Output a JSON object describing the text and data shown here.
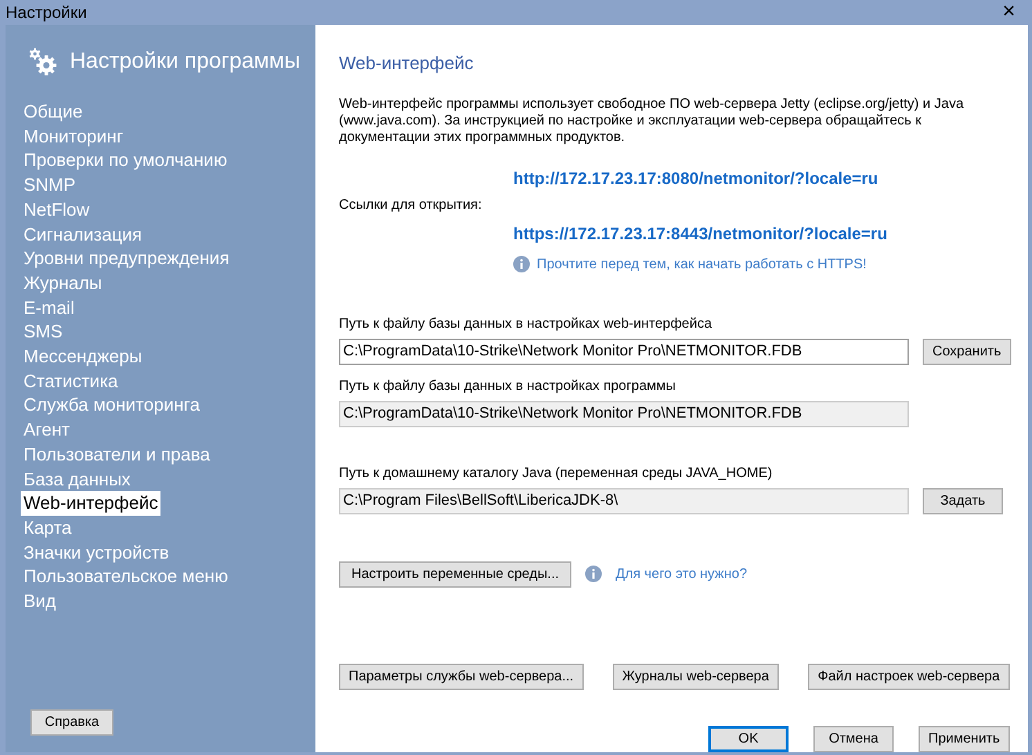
{
  "window": {
    "title": "Настройки",
    "close": "×"
  },
  "sidebar": {
    "title": "Настройки программы",
    "items": [
      {
        "label": "Общие",
        "selected": false
      },
      {
        "label": "Мониторинг",
        "selected": false
      },
      {
        "label": "Проверки по умолчанию",
        "selected": false
      },
      {
        "label": "SNMP",
        "selected": false
      },
      {
        "label": "NetFlow",
        "selected": false
      },
      {
        "label": "Сигнализация",
        "selected": false
      },
      {
        "label": "Уровни предупреждения",
        "selected": false
      },
      {
        "label": "Журналы",
        "selected": false
      },
      {
        "label": "E-mail",
        "selected": false
      },
      {
        "label": "SMS",
        "selected": false
      },
      {
        "label": "Мессенджеры",
        "selected": false
      },
      {
        "label": "Статистика",
        "selected": false
      },
      {
        "label": "Служба мониторинга",
        "selected": false
      },
      {
        "label": "Агент",
        "selected": false
      },
      {
        "label": "Пользователи и права",
        "selected": false
      },
      {
        "label": "База данных",
        "selected": false
      },
      {
        "label": "Web-интерфейс",
        "selected": true
      },
      {
        "label": "Карта",
        "selected": false
      },
      {
        "label": "Значки устройств",
        "selected": false
      },
      {
        "label": "Пользовательское меню",
        "selected": false
      },
      {
        "label": "Вид",
        "selected": false
      }
    ],
    "help_button": "Справка"
  },
  "content": {
    "heading": "Web-интерфейс",
    "description": "Web-интерфейс программы использует свободное ПО web-сервера Jetty (eclipse.org/jetty) и Java (www.java.com). За инструкцией по настройке и эксплуатации web-сервера обращайтесь к документации этих программных продуктов.",
    "links_label": "Ссылки для открытия:",
    "http_link": "http://172.17.23.17:8080/netmonitor/?locale=ru",
    "https_link": "https://172.17.23.17:8443/netmonitor/?locale=ru",
    "https_note": "Прочтите перед тем, как начать работать с HTTPS!",
    "fields": [
      {
        "label": "Путь к файлу базы данных в настройках web-интерфейса",
        "value": "C:\\ProgramData\\10-Strike\\Network Monitor Pro\\NETMONITOR.FDB",
        "disabled": false,
        "button": "Сохранить"
      },
      {
        "label": "Путь к файлу базы данных в настройках программы",
        "value": "C:\\ProgramData\\10-Strike\\Network Monitor Pro\\NETMONITOR.FDB",
        "disabled": true
      },
      {
        "label": "Путь к домашнему каталогу Java (переменная среды JAVA_HOME)",
        "value": "C:\\Program Files\\BellSoft\\LibericaJDK-8\\",
        "disabled": true,
        "button": "Задать"
      }
    ],
    "env_button": "Настроить переменные среды...",
    "env_help": "Для чего это нужно?",
    "server_buttons": [
      "Параметры службы web-сервера...",
      "Журналы web-сервера",
      "Файл настроек web-сервера"
    ]
  },
  "footer": [
    {
      "label": "OK",
      "default": true
    },
    {
      "label": "Отмена",
      "default": false
    },
    {
      "label": "Применить",
      "default": false
    }
  ]
}
